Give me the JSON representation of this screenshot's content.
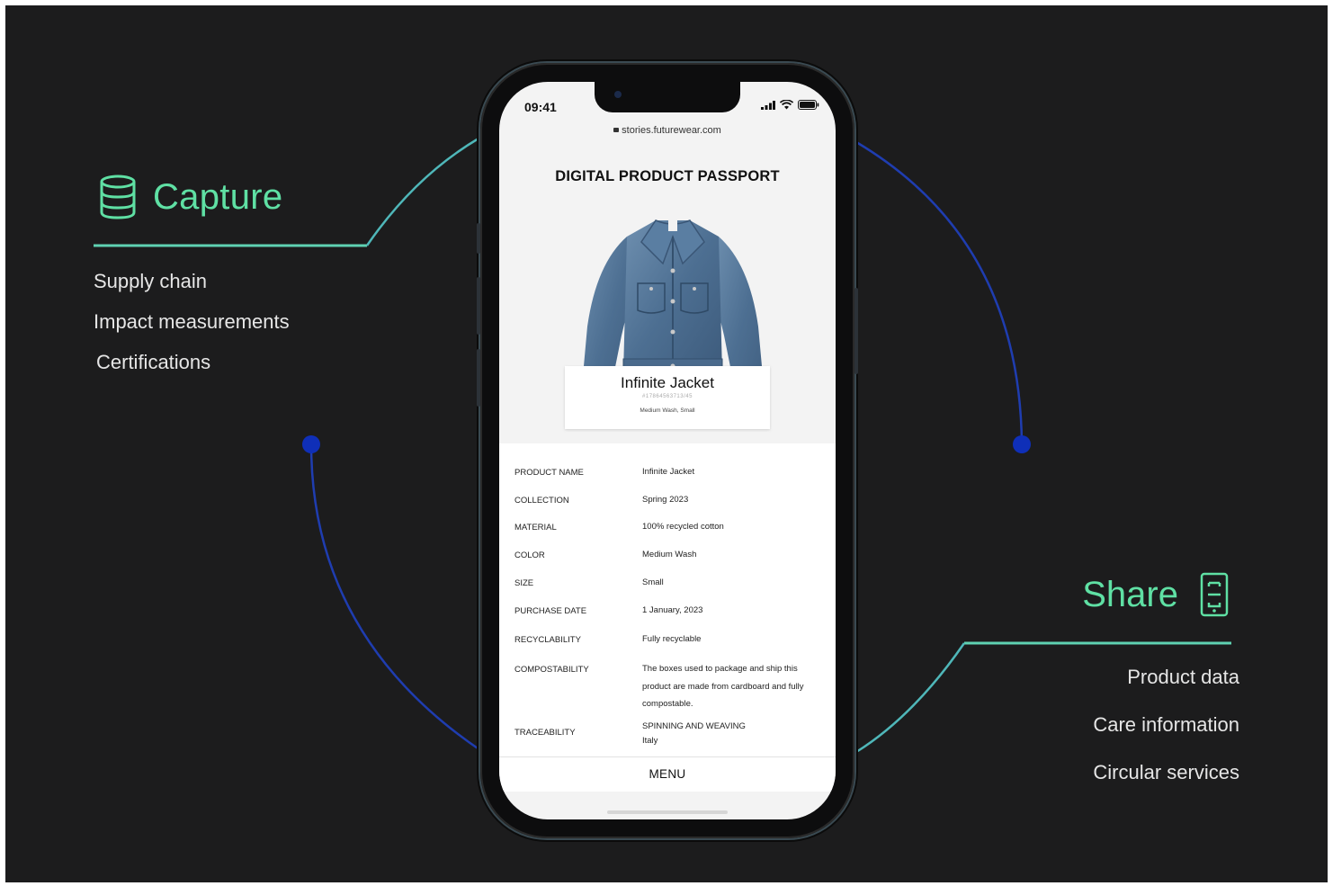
{
  "colors": {
    "background": "#1c1c1d",
    "accent_green": "#5fe0a4",
    "line_teal": "#4fb7b9",
    "line_blue": "#1f3db0",
    "dot_blue": "#0f2fb8"
  },
  "capture": {
    "icon": "database-icon",
    "title": "Capture",
    "items": [
      "Supply chain",
      "Impact measurements",
      "Certifications"
    ]
  },
  "share": {
    "icon": "smartphone-icon",
    "title": "Share",
    "items": [
      "Product data",
      "Care information",
      "Circular services"
    ]
  },
  "phone": {
    "status": {
      "time": "09:41",
      "icons": [
        "signal-icon",
        "wifi-icon",
        "battery-icon"
      ]
    },
    "url": "stories.futurewear.com",
    "page_title": "DIGITAL PRODUCT PASSPORT",
    "product": {
      "image": "denim-jacket-image",
      "name": "Infinite Jacket",
      "sku": "#17864563713/45",
      "variant": "Medium Wash, Small"
    },
    "details": [
      {
        "label": "PRODUCT NAME",
        "value": "Infinite Jacket"
      },
      {
        "label": "COLLECTION",
        "value": "Spring 2023"
      },
      {
        "label": "MATERIAL",
        "value": "100% recycled cotton"
      },
      {
        "label": "COLOR",
        "value": "Medium Wash"
      },
      {
        "label": "SIZE",
        "value": "Small"
      },
      {
        "label": "PURCHASE DATE",
        "value": "1 January, 2023"
      },
      {
        "label": "RECYCLABILITY",
        "value": "Fully recyclable"
      },
      {
        "label": "COMPOSTABILITY",
        "value": "The boxes used to package and ship this product are made from cardboard and fully compostable."
      },
      {
        "label": "TRACEABILITY",
        "value": "SPINNING AND WEAVING",
        "value2": "Italy"
      }
    ],
    "menu_label": "MENU"
  }
}
